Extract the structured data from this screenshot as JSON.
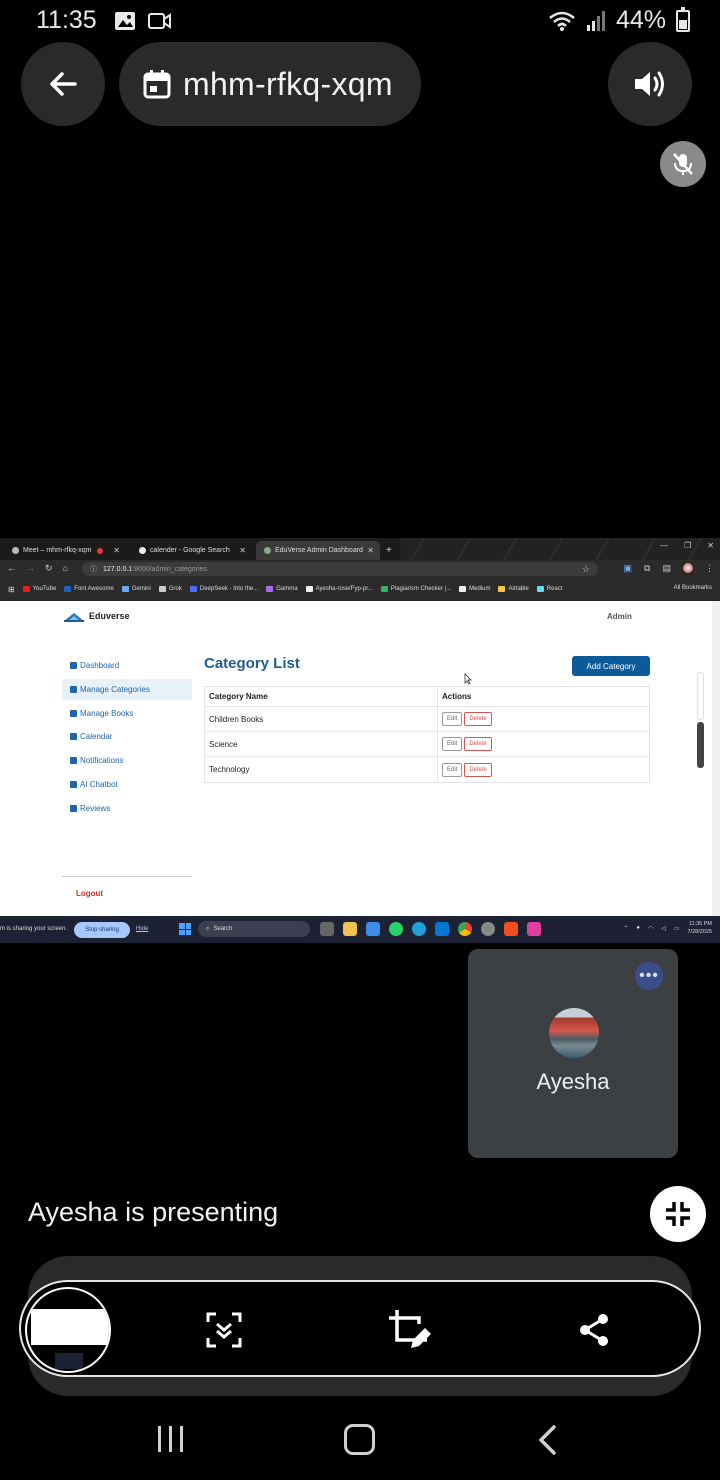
{
  "status_bar": {
    "time": "11:35",
    "battery": "44%"
  },
  "meet": {
    "meeting_code": "mhm-rfkq-xqm",
    "participant_name": "Ayesha",
    "presenting_text": "Ayesha is presenting",
    "more_label": "•••"
  },
  "shared_screen": {
    "tabs": [
      {
        "label": "Meet – mhm-rfkq-xqm"
      },
      {
        "label": "calender - Google Search"
      },
      {
        "label": "EduVerse Admin Dashboard"
      }
    ],
    "url_host": "127.0.0.1",
    "url_path": ":8000/admin_categories",
    "bookmarks": [
      {
        "label": "YouTube",
        "color": "#e62117"
      },
      {
        "label": "Font Awesome",
        "color": "#1c63c5"
      },
      {
        "label": "Gemini",
        "color": "#6ea8fe"
      },
      {
        "label": "Grok",
        "color": "#cccccc"
      },
      {
        "label": "DeepSeek - Into the...",
        "color": "#4d6bfe"
      },
      {
        "label": "Gamma",
        "color": "#a56cf0"
      },
      {
        "label": "Ayesha-rose/Fyp-pr...",
        "color": "#eeeeee"
      },
      {
        "label": "Plagiarism Checker |...",
        "color": "#2fb36a"
      },
      {
        "label": "Medium",
        "color": "#eeeeee"
      },
      {
        "label": "Airtable",
        "color": "#f7c744"
      },
      {
        "label": "React",
        "color": "#61dafb"
      }
    ],
    "all_bookmarks": "All Bookmarks",
    "app": {
      "brand": "Eduverse",
      "admin_label": "Admin",
      "sidebar": [
        {
          "label": "Dashboard",
          "icon": "home-icon"
        },
        {
          "label": "Manage Categories",
          "icon": "tags-icon"
        },
        {
          "label": "Manage Books",
          "icon": "book-icon"
        },
        {
          "label": "Calendar",
          "icon": "calendar-icon"
        },
        {
          "label": "Notifications",
          "icon": "bell-icon"
        },
        {
          "label": "AI Chatbot",
          "icon": "robot-icon"
        },
        {
          "label": "Reviews",
          "icon": "comment-icon"
        }
      ],
      "logout": "Logout",
      "title": "Category List",
      "add_button": "Add Category",
      "table": {
        "headers": [
          "Category Name",
          "Actions"
        ],
        "rows": [
          {
            "name": "Children Books"
          },
          {
            "name": "Science"
          },
          {
            "name": "Technology"
          }
        ],
        "edit_label": "Edit",
        "delete_label": "Delete"
      }
    },
    "taskbar": {
      "share_message": "m is sharing your screen.",
      "stop_sharing": "Stop sharing",
      "hide": "Hide",
      "search": "Search",
      "clock_time": "11:35 PM",
      "clock_date": "7/28/2025"
    }
  }
}
